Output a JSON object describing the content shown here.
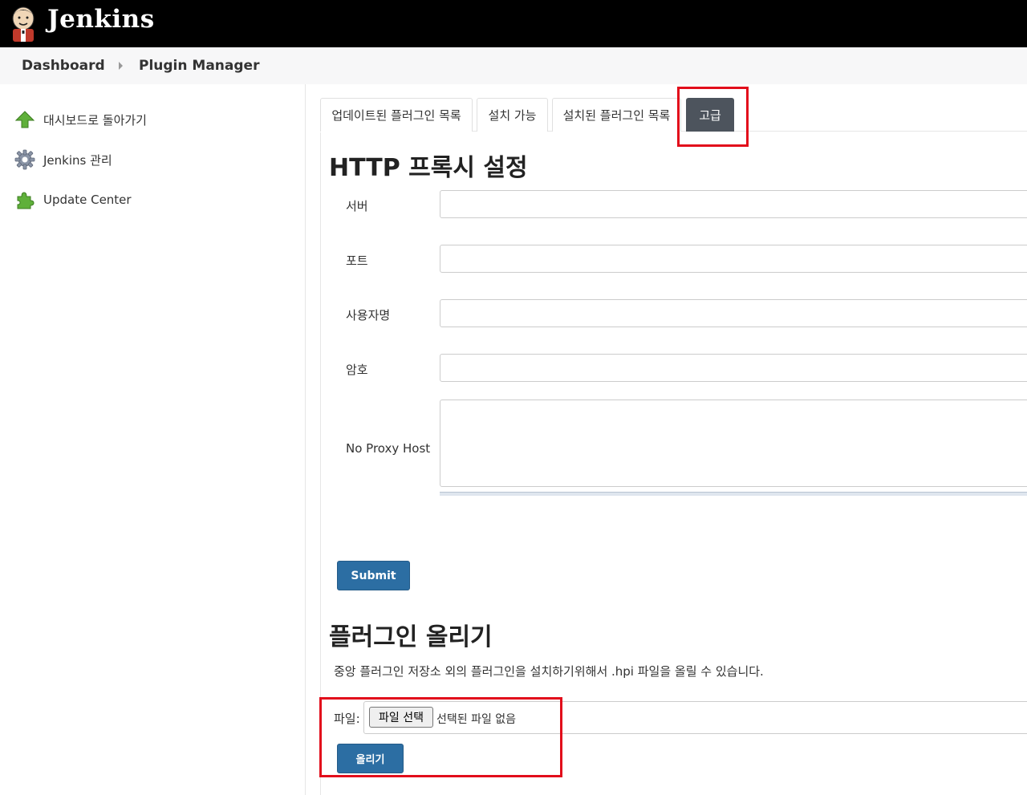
{
  "header": {
    "title": "Jenkins",
    "logo_icon": "jenkins-butler-icon"
  },
  "breadcrumb": {
    "items": [
      "Dashboard",
      "Plugin Manager"
    ]
  },
  "sidebar": {
    "items": [
      {
        "label": "대시보드로 돌아가기",
        "icon": "up-arrow-icon"
      },
      {
        "label": "Jenkins 관리",
        "icon": "gear-icon"
      },
      {
        "label": "Update Center",
        "icon": "puzzle-icon"
      }
    ]
  },
  "tabs": {
    "items": [
      "업데이트된 플러그인 목록",
      "설치 가능",
      "설치된 플러그인 목록",
      "고급"
    ],
    "active": "고급"
  },
  "proxy": {
    "title": "HTTP 프록시 설정",
    "fields": [
      {
        "label": "서버",
        "value": ""
      },
      {
        "label": "포트",
        "value": ""
      },
      {
        "label": "사용자명",
        "value": ""
      },
      {
        "label": "암호",
        "value": ""
      },
      {
        "label": "No Proxy Host",
        "value": ""
      }
    ],
    "submit_label": "Submit"
  },
  "upload": {
    "title": "플러그인 올리기",
    "description": "중앙 플러그인 저장소 외의 플러그인을 설치하기위해서 .hpi 파일을 올릴 수 있습니다.",
    "file_label": "파일:",
    "choose_file_label": "파일 선택",
    "file_status": "선택된 파일 없음",
    "upload_button_label": "올리기"
  },
  "colors": {
    "header_bg": "#000000",
    "primary_button": "#2c6ea3",
    "active_tab": "#4d545d",
    "highlight": "#e20d1b"
  }
}
